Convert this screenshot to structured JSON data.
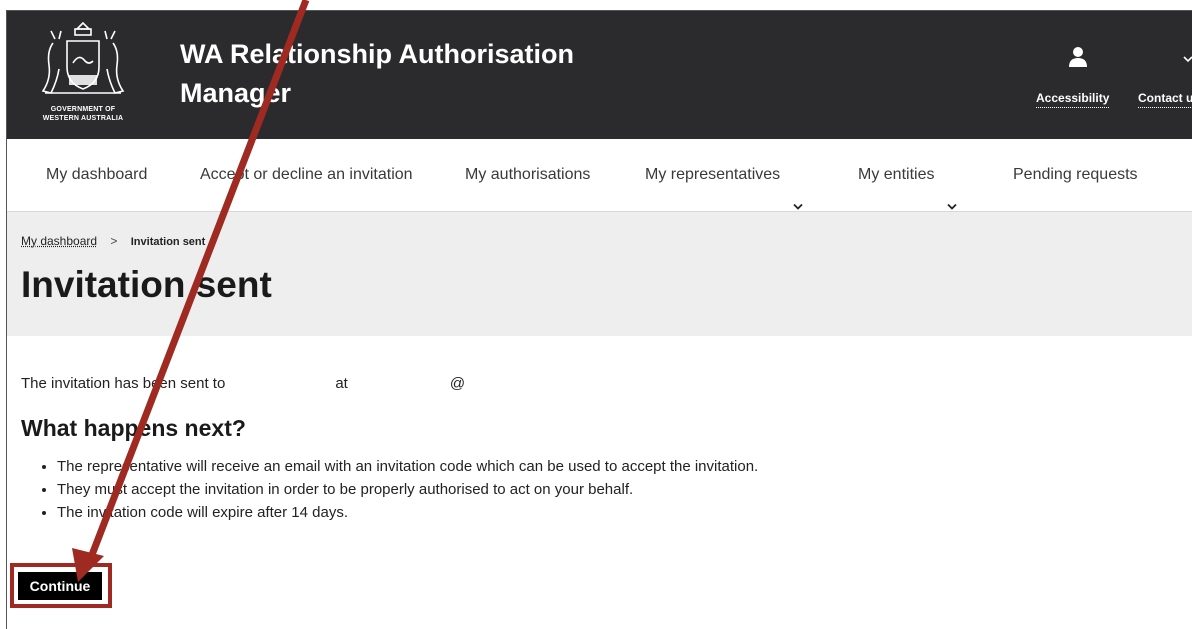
{
  "header": {
    "crest_text_1": "GOVERNMENT OF",
    "crest_text_2": "WESTERN AUSTRALIA",
    "app_title_1": "WA Relationship Authorisation",
    "app_title_2": "Manager",
    "accessibility": "Accessibility",
    "contact": "Contact u"
  },
  "nav": {
    "items": [
      {
        "label": "My dashboard"
      },
      {
        "label": "Accept or decline an invitation"
      },
      {
        "label": "My authorisations"
      },
      {
        "label": "My representatives"
      },
      {
        "label": "My entities"
      },
      {
        "label": "Pending requests"
      }
    ]
  },
  "breadcrumb": {
    "home": "My dashboard",
    "separator": ">",
    "current": "Invitation sent"
  },
  "page": {
    "title": "Invitation sent",
    "sent_prefix": "The invitation has been sent to",
    "sent_at": "at",
    "sent_email_at": "@",
    "next_title": "What happens next?",
    "bullets": [
      "The representative will receive an email with an invitation code which can be used to accept the invitation.",
      "They must accept the invitation in order to be properly authorised to act on your behalf.",
      "The invitation code will expire after 14 days."
    ],
    "continue_label": "Continue"
  },
  "colors": {
    "header_bg": "#2b2b2d",
    "annotation": "#9e2a22",
    "heading_band": "#eeeeee"
  },
  "icons": {
    "user": "user-icon",
    "chevron": "chevron-down-icon",
    "crest": "wa-government-crest-icon"
  }
}
